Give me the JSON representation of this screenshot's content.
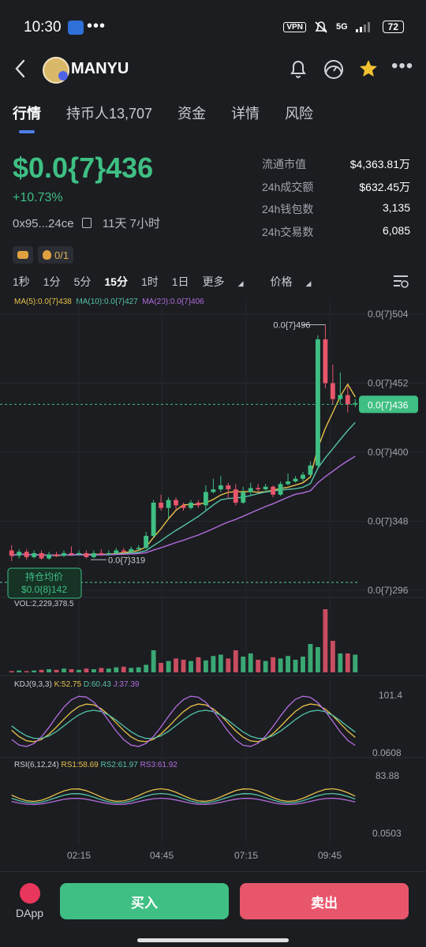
{
  "status_bar": {
    "time": "10:30",
    "dots": "•••",
    "vpn": "VPN",
    "signal": "5G",
    "battery": "72"
  },
  "header": {
    "token_name": "MANYU",
    "icons": [
      "back-icon",
      "bell-icon",
      "gauge-icon",
      "star-icon",
      "more-icon"
    ]
  },
  "tabs": [
    "行情",
    "持币人13,707",
    "资金",
    "详情",
    "风险"
  ],
  "price": {
    "value": "$0.0{7}436",
    "change": "+10.73%",
    "address": "0x95...24ce",
    "age": "11天 7小时"
  },
  "stats": [
    {
      "label": "流通市值",
      "value": "$4,363.81万"
    },
    {
      "label": "24h成交额",
      "value": "$632.45万"
    },
    {
      "label": "24h钱包数",
      "value": "3,135"
    },
    {
      "label": "24h交易数",
      "value": "6,085"
    }
  ],
  "pills": {
    "bag_value": "0/1"
  },
  "intervals": [
    "1秒",
    "1分",
    "5分",
    "15分",
    "1时",
    "1日",
    "更多",
    "价格"
  ],
  "selected_interval": "15分",
  "ma_labels": {
    "ma5": "MA(5):0.0{7}438",
    "ma10": "MA(10):0.0{7}427",
    "ma20": "MA(20):0.0{7}406"
  },
  "colors": {
    "up": "#3fbf83",
    "down": "#e8566b",
    "ma5": "#e7c04b",
    "ma10": "#55c3a9",
    "ma20": "#b46ddd",
    "accent": "#4f7ee8"
  },
  "chart_data": {
    "type": "candlestick",
    "y_ticks": [
      "0.0{7}504",
      "0.0{7}452",
      "0.0{7}400",
      "0.0{7}348",
      "0.0{7}296"
    ],
    "ylim": [
      296,
      504
    ],
    "current_price_label": "0.0{7}436",
    "max_label": "0.0{7}496",
    "min_label": "0.0{7}319",
    "avg_cost_title": "持仓均价",
    "avg_cost_value": "$0.0{8}142",
    "x_ticks": [
      "02:15",
      "04:45",
      "07:15",
      "09:45"
    ],
    "volume_label": "VOL:2,229,378.5",
    "kdj": {
      "label": "KDJ(9,3,3)",
      "k": "K:52.75",
      "d": "D:60.43",
      "j": "J:37.39",
      "max": "101.4",
      "min": "0.0608"
    },
    "rsi": {
      "label": "RSI(6,12,24)",
      "rs1": "RS1:58.69",
      "rs2": "RS2:61.97",
      "rs3": "RS3:61.92",
      "max": "83.88",
      "min": "0.0503"
    },
    "candles": [
      {
        "o": 326,
        "c": 322,
        "h": 330,
        "l": 318
      },
      {
        "o": 322,
        "c": 325,
        "h": 327,
        "l": 320
      },
      {
        "o": 325,
        "c": 321,
        "h": 327,
        "l": 319
      },
      {
        "o": 321,
        "c": 324,
        "h": 326,
        "l": 320
      },
      {
        "o": 324,
        "c": 320,
        "h": 326,
        "l": 319
      },
      {
        "o": 320,
        "c": 323,
        "h": 325,
        "l": 319
      },
      {
        "o": 323,
        "c": 322,
        "h": 325,
        "l": 321
      },
      {
        "o": 322,
        "c": 324,
        "h": 326,
        "l": 321
      },
      {
        "o": 324,
        "c": 323,
        "h": 329,
        "l": 322
      },
      {
        "o": 323,
        "c": 324,
        "h": 326,
        "l": 322
      },
      {
        "o": 324,
        "c": 321,
        "h": 326,
        "l": 320
      },
      {
        "o": 321,
        "c": 324,
        "h": 326,
        "l": 320
      },
      {
        "o": 324,
        "c": 323,
        "h": 327,
        "l": 322
      },
      {
        "o": 323,
        "c": 324,
        "h": 326,
        "l": 322
      },
      {
        "o": 324,
        "c": 326,
        "h": 328,
        "l": 323
      },
      {
        "o": 326,
        "c": 325,
        "h": 328,
        "l": 324
      },
      {
        "o": 325,
        "c": 327,
        "h": 329,
        "l": 324
      },
      {
        "o": 327,
        "c": 328,
        "h": 330,
        "l": 326
      },
      {
        "o": 328,
        "c": 337,
        "h": 340,
        "l": 327
      },
      {
        "o": 337,
        "c": 362,
        "h": 364,
        "l": 336
      },
      {
        "o": 362,
        "c": 358,
        "h": 368,
        "l": 356
      },
      {
        "o": 358,
        "c": 364,
        "h": 366,
        "l": 350
      },
      {
        "o": 364,
        "c": 360,
        "h": 366,
        "l": 357
      },
      {
        "o": 360,
        "c": 358,
        "h": 362,
        "l": 356
      },
      {
        "o": 358,
        "c": 362,
        "h": 364,
        "l": 357
      },
      {
        "o": 362,
        "c": 360,
        "h": 364,
        "l": 358
      },
      {
        "o": 360,
        "c": 370,
        "h": 375,
        "l": 356
      },
      {
        "o": 370,
        "c": 372,
        "h": 380,
        "l": 369
      },
      {
        "o": 372,
        "c": 375,
        "h": 382,
        "l": 370
      },
      {
        "o": 375,
        "c": 372,
        "h": 377,
        "l": 365
      },
      {
        "o": 372,
        "c": 362,
        "h": 376,
        "l": 360
      },
      {
        "o": 362,
        "c": 370,
        "h": 374,
        "l": 361
      },
      {
        "o": 370,
        "c": 373,
        "h": 377,
        "l": 368
      },
      {
        "o": 373,
        "c": 372,
        "h": 376,
        "l": 370
      },
      {
        "o": 372,
        "c": 374,
        "h": 376,
        "l": 371
      },
      {
        "o": 374,
        "c": 368,
        "h": 375,
        "l": 366
      },
      {
        "o": 368,
        "c": 376,
        "h": 378,
        "l": 367
      },
      {
        "o": 376,
        "c": 378,
        "h": 384,
        "l": 375
      },
      {
        "o": 378,
        "c": 380,
        "h": 382,
        "l": 377
      },
      {
        "o": 380,
        "c": 383,
        "h": 385,
        "l": 378
      },
      {
        "o": 383,
        "c": 390,
        "h": 393,
        "l": 382
      },
      {
        "o": 390,
        "c": 485,
        "h": 488,
        "l": 388
      },
      {
        "o": 485,
        "c": 452,
        "h": 496,
        "l": 448
      },
      {
        "o": 452,
        "c": 440,
        "h": 466,
        "l": 436
      },
      {
        "o": 440,
        "c": 443,
        "h": 460,
        "l": 436
      },
      {
        "o": 443,
        "c": 436,
        "h": 450,
        "l": 430
      },
      {
        "o": 436,
        "c": 437,
        "h": 440,
        "l": 434
      }
    ],
    "volumes": [
      0.02,
      0.03,
      0.02,
      0.03,
      0.04,
      0.05,
      0.04,
      0.06,
      0.05,
      0.04,
      0.06,
      0.05,
      0.07,
      0.06,
      0.08,
      0.09,
      0.07,
      0.08,
      0.12,
      0.35,
      0.15,
      0.18,
      0.22,
      0.2,
      0.18,
      0.24,
      0.19,
      0.26,
      0.28,
      0.22,
      0.35,
      0.25,
      0.3,
      0.2,
      0.18,
      0.24,
      0.22,
      0.26,
      0.2,
      0.25,
      0.45,
      0.4,
      1.0,
      0.5,
      0.3,
      0.3,
      0.28
    ]
  },
  "bottom": {
    "dapp_label": "DApp",
    "buy_label": "买入",
    "sell_label": "卖出"
  }
}
